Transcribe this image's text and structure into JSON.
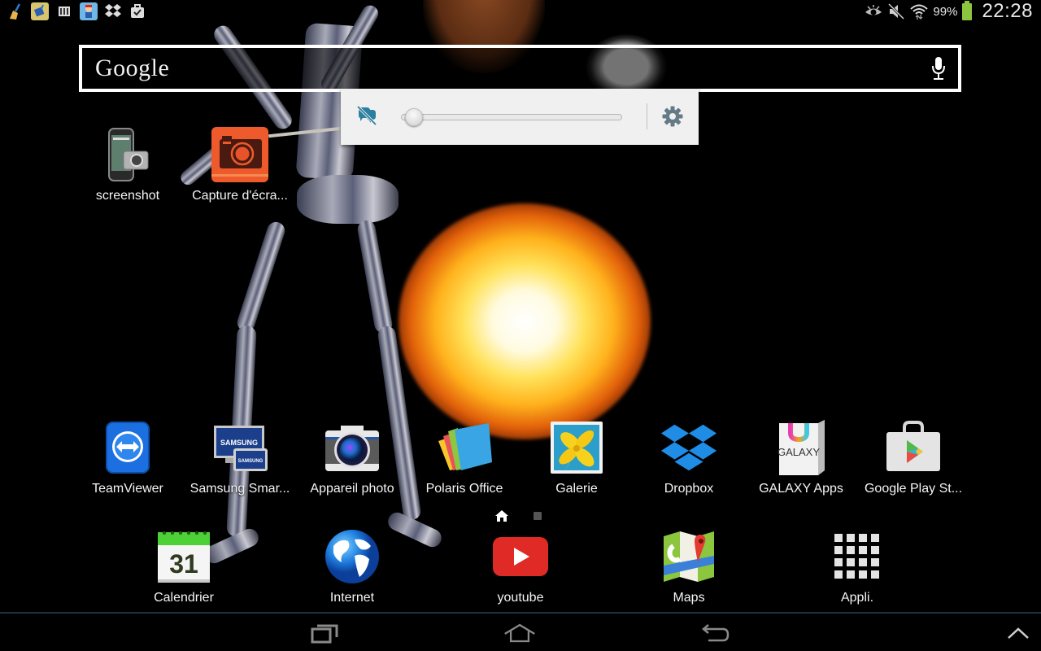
{
  "status_bar": {
    "notification_icons": [
      "clean-master-broom-icon",
      "clean-master-widget-icon",
      "usb-storage-icon",
      "game-app-icon",
      "dropbox-icon",
      "task-done-icon"
    ],
    "system_icons": [
      "eye-smart-stay-icon",
      "sound-muted-icon",
      "wifi-icon"
    ],
    "battery_percent": "99%",
    "battery_color": "#8cc63e",
    "time": "22:28"
  },
  "search_widget": {
    "logo_text": "Google",
    "voice_icon": "mic-icon"
  },
  "brightness_panel": {
    "auto_icon": "auto-brightness-off-icon",
    "brightness_level": 0.02,
    "settings_icon": "gear-icon",
    "accent_color": "#2b7fa0"
  },
  "desktop_shortcuts": [
    {
      "label": "screenshot",
      "icon": "phone-camera-icon"
    },
    {
      "label": "Capture d'écra...",
      "icon": "screen-capture-icon"
    }
  ],
  "app_row": [
    {
      "label": "TeamViewer",
      "icon": "teamviewer-icon"
    },
    {
      "label": "Samsung Smar...",
      "icon": "samsung-smart-switch-icon"
    },
    {
      "label": "Appareil photo",
      "icon": "camera-icon"
    },
    {
      "label": "Polaris Office",
      "icon": "polaris-office-icon"
    },
    {
      "label": "Galerie",
      "icon": "gallery-icon"
    },
    {
      "label": "Dropbox",
      "icon": "dropbox-icon"
    },
    {
      "label": "GALAXY Apps",
      "icon": "galaxy-apps-icon"
    },
    {
      "label": "Google Play St...",
      "icon": "play-store-icon"
    }
  ],
  "galaxy_icon_text": "GALAXY",
  "calendar_day": "31",
  "page_indicator": {
    "pages": 2,
    "current": 1
  },
  "dock": [
    {
      "label": "Calendrier",
      "icon": "calendar-icon"
    },
    {
      "label": "Internet",
      "icon": "globe-icon"
    },
    {
      "label": "youtube",
      "icon": "youtube-icon"
    },
    {
      "label": "Maps",
      "icon": "maps-icon"
    },
    {
      "label": "Appli.",
      "icon": "app-drawer-icon"
    }
  ],
  "nav_bar": {
    "buttons": [
      "recent-apps-icon",
      "home-icon",
      "back-icon",
      "chevron-up-icon"
    ]
  }
}
